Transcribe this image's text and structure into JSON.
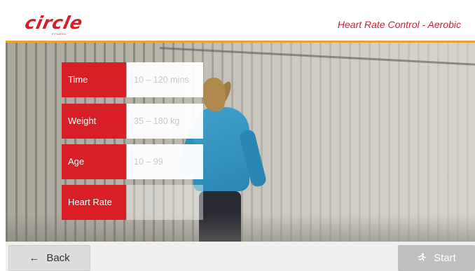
{
  "header": {
    "logo_text": "circle",
    "logo_sub": "FITNESS",
    "program_title": "Heart Rate Control - Aerobic"
  },
  "form": {
    "rows": [
      {
        "label": "Time",
        "placeholder": "10 – 120 mins"
      },
      {
        "label": "Weight",
        "placeholder": "35 – 180 kg"
      },
      {
        "label": "Age",
        "placeholder": "10 – 99"
      },
      {
        "label": "Heart Rate",
        "placeholder": ""
      }
    ]
  },
  "footer": {
    "back_label": "Back",
    "back_icon": "←",
    "start_label": "Start",
    "start_icon": "runner-icon"
  },
  "colors": {
    "brand_red": "#d81f26",
    "header_accent": "#e8a23a",
    "start_disabled": "#bfbfbd"
  }
}
